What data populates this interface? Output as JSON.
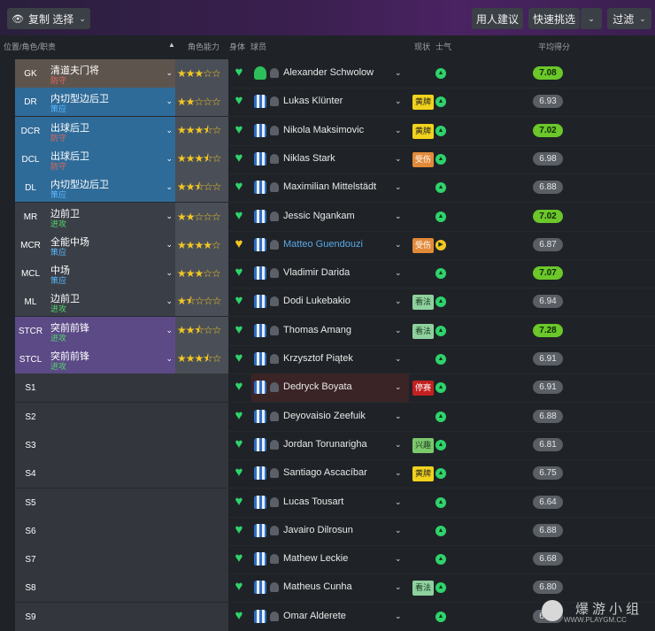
{
  "toolbar": {
    "select_label": "复制 选择",
    "advice_label": "用人建议",
    "quickpick_label": "快速挑选",
    "filter_label": "过滤"
  },
  "headers": {
    "position_role": "位置/角色/职责",
    "role_ability": "角色能力",
    "condition": "身体",
    "player": "球员",
    "status": "现状",
    "morale": "士气",
    "avg_rating": "平均得分"
  },
  "colors": {
    "gk_band": "#5e544e",
    "defense_band": "#2f6b98",
    "midfield_band": "#3a3f47",
    "attack_band": "#5b4a86",
    "sub_band": "#33373d",
    "role_defend": "#e36a5a",
    "role_support": "#5bb7ff",
    "role_attack": "#55d36b"
  },
  "rows": [
    {
      "pos": "GK",
      "role": "清道夫门将",
      "duty": "防守",
      "duty_type": "defend",
      "band": "gk",
      "stars": "★★★☆☆",
      "player": "Alexander Schwolow",
      "kit": "gk",
      "status": "",
      "morale": "▲",
      "rating": "7.08",
      "rating_good": true
    },
    {
      "pos": "DR",
      "role": "内切型边后卫",
      "duty": "策应",
      "duty_type": "support",
      "band": "def",
      "stars": "★★☆☆☆",
      "player": "Lukas Klünter",
      "kit": "",
      "status": "黄牌",
      "status_type": "yellow",
      "morale": "▲",
      "rating": "6.93",
      "rating_good": false
    },
    {
      "pos": "DCR",
      "role": "出球后卫",
      "duty": "防守",
      "duty_type": "defend",
      "band": "def",
      "stars": "★★★⯪☆",
      "player": "Nikola Maksimovic",
      "kit": "",
      "status": "黄牌",
      "status_type": "yellow",
      "morale": "▲",
      "rating": "7.02",
      "rating_good": true
    },
    {
      "pos": "DCL",
      "role": "出球后卫",
      "duty": "防守",
      "duty_type": "defend",
      "band": "def",
      "stars": "★★★⯪☆",
      "player": "Niklas Stark",
      "kit": "",
      "status": "受伤",
      "status_type": "injury",
      "morale": "▲",
      "rating": "6.98",
      "rating_good": false
    },
    {
      "pos": "DL",
      "role": "内切型边后卫",
      "duty": "策应",
      "duty_type": "support",
      "band": "def",
      "stars": "★★⯪☆☆",
      "player": "Maximilian Mittelstädt",
      "kit": "",
      "status": "",
      "morale": "▲",
      "rating": "6.88",
      "rating_good": false
    },
    {
      "pos": "MR",
      "role": "边前卫",
      "duty": "进攻",
      "duty_type": "attack",
      "band": "mid",
      "stars": "★★☆☆☆",
      "player": "Jessic Ngankam",
      "kit": "",
      "status": "",
      "morale": "▲",
      "rating": "7.02",
      "rating_good": true
    },
    {
      "pos": "MCR",
      "role": "全能中场",
      "duty": "策应",
      "duty_type": "support",
      "band": "mid",
      "stars": "★★★★☆",
      "player": "Matteo Guendouzi",
      "kit": "",
      "link": true,
      "heart_yellow": true,
      "status": "受伤",
      "status_type": "injury",
      "morale": "▶",
      "morale_yellow": true,
      "rating": "6.87",
      "rating_good": false
    },
    {
      "pos": "MCL",
      "role": "中场",
      "duty": "策应",
      "duty_type": "support",
      "band": "mid",
      "stars": "★★★☆☆",
      "player": "Vladimir Darida",
      "kit": "",
      "status": "",
      "morale": "▲",
      "rating": "7.07",
      "rating_good": true
    },
    {
      "pos": "ML",
      "role": "边前卫",
      "duty": "进攻",
      "duty_type": "attack",
      "band": "mid",
      "stars": "★⯪☆☆☆",
      "player": "Dodi Lukebakio",
      "kit": "",
      "status": "看法",
      "status_type": "view",
      "morale": "▲",
      "rating": "6.94",
      "rating_good": false
    },
    {
      "pos": "STCR",
      "role": "突前前锋",
      "duty": "进攻",
      "duty_type": "attack",
      "band": "att",
      "stars": "★★⯪☆☆",
      "player": "Thomas Amang",
      "kit": "",
      "status": "看法",
      "status_type": "view",
      "morale": "▲",
      "rating": "7.28",
      "rating_good": true
    },
    {
      "pos": "STCL",
      "role": "突前前锋",
      "duty": "进攻",
      "duty_type": "attack",
      "band": "att",
      "stars": "★★★⯪☆",
      "player": "Krzysztof Piątek",
      "kit": "",
      "status": "",
      "morale": "▲",
      "rating": "6.91",
      "rating_good": false
    },
    {
      "pos": "S1",
      "role": "",
      "duty": "",
      "band": "sub",
      "stars": "",
      "player": "Dedryck Boyata",
      "kit": "",
      "status": "停赛",
      "status_type": "ban",
      "morale": "▲",
      "rating": "6.91",
      "rating_good": false,
      "selected": true
    },
    {
      "pos": "S2",
      "role": "",
      "duty": "",
      "band": "sub",
      "stars": "",
      "player": "Deyovaisio Zeefuik",
      "kit": "",
      "status": "",
      "morale": "▲",
      "rating": "6.88",
      "rating_good": false
    },
    {
      "pos": "S3",
      "role": "",
      "duty": "",
      "band": "sub",
      "stars": "",
      "player": "Jordan Torunarigha",
      "kit": "",
      "status": "兴趣",
      "status_type": "interest",
      "morale": "▲",
      "rating": "6.81",
      "rating_good": false
    },
    {
      "pos": "S4",
      "role": "",
      "duty": "",
      "band": "sub",
      "stars": "",
      "player": "Santiago Ascacíbar",
      "kit": "",
      "status": "黄牌",
      "status_type": "yellow",
      "morale": "▲",
      "rating": "6.75",
      "rating_good": false
    },
    {
      "pos": "S5",
      "role": "",
      "duty": "",
      "band": "sub",
      "stars": "",
      "player": "Lucas Tousart",
      "kit": "",
      "status": "",
      "morale": "▲",
      "rating": "6.64",
      "rating_good": false
    },
    {
      "pos": "S6",
      "role": "",
      "duty": "",
      "band": "sub",
      "stars": "",
      "player": "Javairo Dilrosun",
      "kit": "",
      "status": "",
      "morale": "▲",
      "rating": "6.88",
      "rating_good": false
    },
    {
      "pos": "S7",
      "role": "",
      "duty": "",
      "band": "sub",
      "stars": "",
      "player": "Mathew Leckie",
      "kit": "",
      "status": "",
      "morale": "▲",
      "rating": "6.68",
      "rating_good": false
    },
    {
      "pos": "S8",
      "role": "",
      "duty": "",
      "band": "sub",
      "stars": "",
      "player": "Matheus Cunha",
      "kit": "",
      "status": "看法",
      "status_type": "view",
      "morale": "▲",
      "rating": "6.80",
      "rating_good": false
    },
    {
      "pos": "S9",
      "role": "",
      "duty": "",
      "band": "sub",
      "stars": "",
      "player": "Omar Alderete",
      "kit": "",
      "status": "",
      "morale": "▲",
      "rating": "6.91",
      "rating_good": false
    }
  ],
  "watermark": {
    "text": "爆游小组",
    "url": "WWW.PLAYGM.CC"
  }
}
